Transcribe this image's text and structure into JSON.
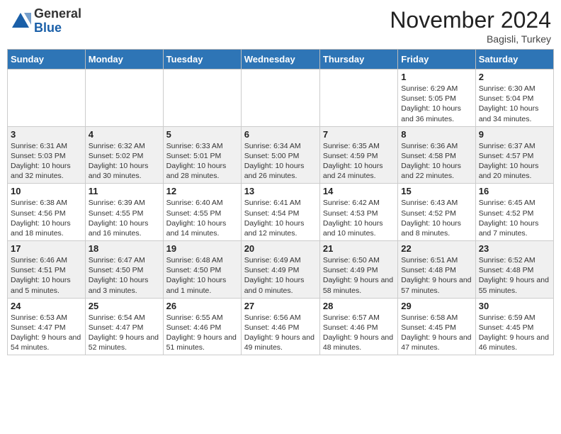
{
  "header": {
    "logo_general": "General",
    "logo_blue": "Blue",
    "month_title": "November 2024",
    "location": "Bagisli, Turkey"
  },
  "days_of_week": [
    "Sunday",
    "Monday",
    "Tuesday",
    "Wednesday",
    "Thursday",
    "Friday",
    "Saturday"
  ],
  "weeks": [
    [
      {
        "day": "",
        "info": ""
      },
      {
        "day": "",
        "info": ""
      },
      {
        "day": "",
        "info": ""
      },
      {
        "day": "",
        "info": ""
      },
      {
        "day": "",
        "info": ""
      },
      {
        "day": "1",
        "info": "Sunrise: 6:29 AM\nSunset: 5:05 PM\nDaylight: 10 hours and 36 minutes."
      },
      {
        "day": "2",
        "info": "Sunrise: 6:30 AM\nSunset: 5:04 PM\nDaylight: 10 hours and 34 minutes."
      }
    ],
    [
      {
        "day": "3",
        "info": "Sunrise: 6:31 AM\nSunset: 5:03 PM\nDaylight: 10 hours and 32 minutes."
      },
      {
        "day": "4",
        "info": "Sunrise: 6:32 AM\nSunset: 5:02 PM\nDaylight: 10 hours and 30 minutes."
      },
      {
        "day": "5",
        "info": "Sunrise: 6:33 AM\nSunset: 5:01 PM\nDaylight: 10 hours and 28 minutes."
      },
      {
        "day": "6",
        "info": "Sunrise: 6:34 AM\nSunset: 5:00 PM\nDaylight: 10 hours and 26 minutes."
      },
      {
        "day": "7",
        "info": "Sunrise: 6:35 AM\nSunset: 4:59 PM\nDaylight: 10 hours and 24 minutes."
      },
      {
        "day": "8",
        "info": "Sunrise: 6:36 AM\nSunset: 4:58 PM\nDaylight: 10 hours and 22 minutes."
      },
      {
        "day": "9",
        "info": "Sunrise: 6:37 AM\nSunset: 4:57 PM\nDaylight: 10 hours and 20 minutes."
      }
    ],
    [
      {
        "day": "10",
        "info": "Sunrise: 6:38 AM\nSunset: 4:56 PM\nDaylight: 10 hours and 18 minutes."
      },
      {
        "day": "11",
        "info": "Sunrise: 6:39 AM\nSunset: 4:55 PM\nDaylight: 10 hours and 16 minutes."
      },
      {
        "day": "12",
        "info": "Sunrise: 6:40 AM\nSunset: 4:55 PM\nDaylight: 10 hours and 14 minutes."
      },
      {
        "day": "13",
        "info": "Sunrise: 6:41 AM\nSunset: 4:54 PM\nDaylight: 10 hours and 12 minutes."
      },
      {
        "day": "14",
        "info": "Sunrise: 6:42 AM\nSunset: 4:53 PM\nDaylight: 10 hours and 10 minutes."
      },
      {
        "day": "15",
        "info": "Sunrise: 6:43 AM\nSunset: 4:52 PM\nDaylight: 10 hours and 8 minutes."
      },
      {
        "day": "16",
        "info": "Sunrise: 6:45 AM\nSunset: 4:52 PM\nDaylight: 10 hours and 7 minutes."
      }
    ],
    [
      {
        "day": "17",
        "info": "Sunrise: 6:46 AM\nSunset: 4:51 PM\nDaylight: 10 hours and 5 minutes."
      },
      {
        "day": "18",
        "info": "Sunrise: 6:47 AM\nSunset: 4:50 PM\nDaylight: 10 hours and 3 minutes."
      },
      {
        "day": "19",
        "info": "Sunrise: 6:48 AM\nSunset: 4:50 PM\nDaylight: 10 hours and 1 minute."
      },
      {
        "day": "20",
        "info": "Sunrise: 6:49 AM\nSunset: 4:49 PM\nDaylight: 10 hours and 0 minutes."
      },
      {
        "day": "21",
        "info": "Sunrise: 6:50 AM\nSunset: 4:49 PM\nDaylight: 9 hours and 58 minutes."
      },
      {
        "day": "22",
        "info": "Sunrise: 6:51 AM\nSunset: 4:48 PM\nDaylight: 9 hours and 57 minutes."
      },
      {
        "day": "23",
        "info": "Sunrise: 6:52 AM\nSunset: 4:48 PM\nDaylight: 9 hours and 55 minutes."
      }
    ],
    [
      {
        "day": "24",
        "info": "Sunrise: 6:53 AM\nSunset: 4:47 PM\nDaylight: 9 hours and 54 minutes."
      },
      {
        "day": "25",
        "info": "Sunrise: 6:54 AM\nSunset: 4:47 PM\nDaylight: 9 hours and 52 minutes."
      },
      {
        "day": "26",
        "info": "Sunrise: 6:55 AM\nSunset: 4:46 PM\nDaylight: 9 hours and 51 minutes."
      },
      {
        "day": "27",
        "info": "Sunrise: 6:56 AM\nSunset: 4:46 PM\nDaylight: 9 hours and 49 minutes."
      },
      {
        "day": "28",
        "info": "Sunrise: 6:57 AM\nSunset: 4:46 PM\nDaylight: 9 hours and 48 minutes."
      },
      {
        "day": "29",
        "info": "Sunrise: 6:58 AM\nSunset: 4:45 PM\nDaylight: 9 hours and 47 minutes."
      },
      {
        "day": "30",
        "info": "Sunrise: 6:59 AM\nSunset: 4:45 PM\nDaylight: 9 hours and 46 minutes."
      }
    ]
  ]
}
